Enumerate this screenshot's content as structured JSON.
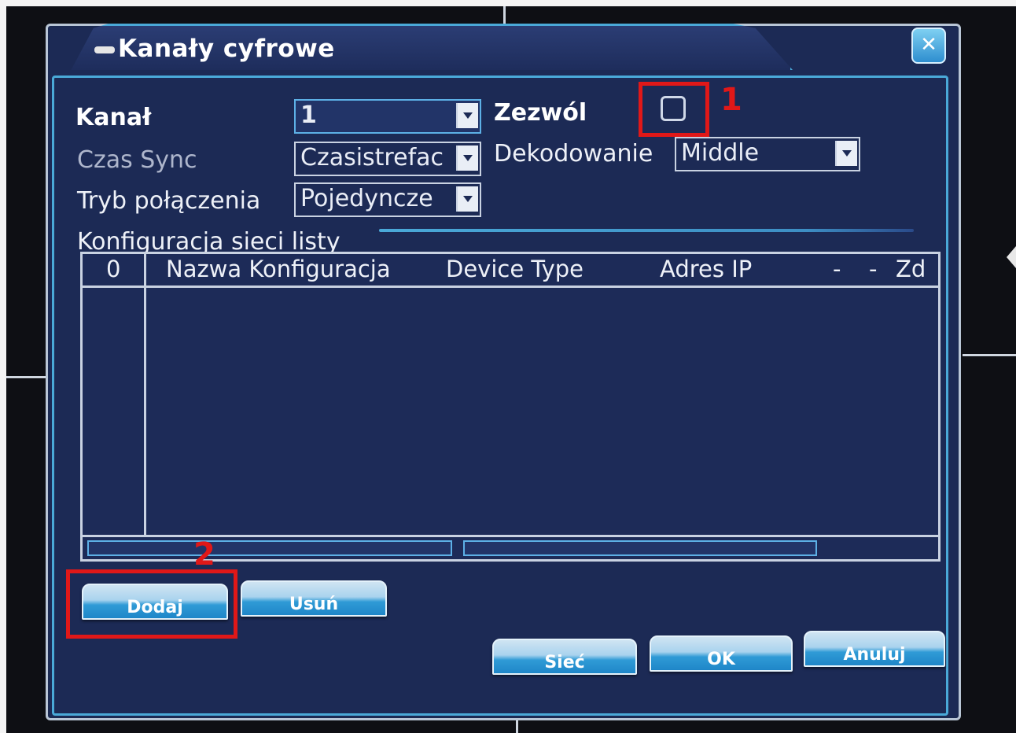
{
  "window": {
    "title": "Kanały cyfrowe",
    "close_icon": "x-close-icon"
  },
  "form": {
    "channel_label": "Kanał",
    "channel_value": "1",
    "enable_label": "Zezwól",
    "sync_label": "Czas Sync",
    "sync_value": "Czasistrefac",
    "decode_label": "Dekodowanie",
    "decode_value": "Middle",
    "mode_label": "Tryb połączenia",
    "mode_value": "Pojedyncze"
  },
  "network": {
    "section_title": "Konfiguracja sieci listy",
    "columns": [
      "0",
      "Nazwa Konfiguracja",
      "Device Type",
      "Adres IP",
      "-",
      "-",
      "Zd"
    ],
    "rows": []
  },
  "annotations": {
    "marker_1": "1",
    "marker_2": "2",
    "color": "#e01818"
  },
  "buttons": {
    "add_label": "Dodaj",
    "delete_label": "Usuń",
    "net_label": "Sieć",
    "ok_label": "OK",
    "cancel_label": "Anuluj"
  },
  "colors": {
    "panel": "#1c2a55",
    "accent": "#4aa9d8",
    "button": "#1f86c8"
  }
}
